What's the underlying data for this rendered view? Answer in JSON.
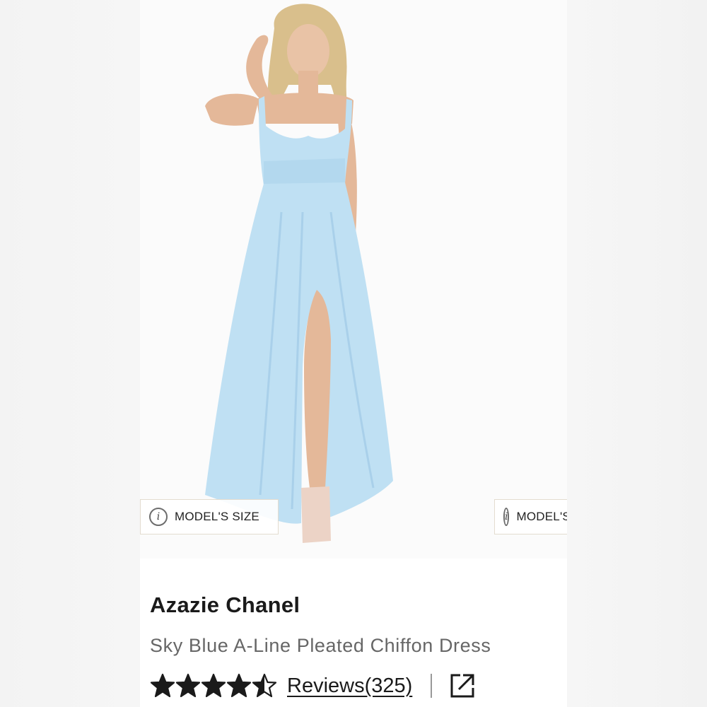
{
  "product": {
    "brand": "Azazie Chanel",
    "subtitle": "Sky Blue A-Line Pleated Chiffon Dress",
    "reviews_label": "Reviews(325)",
    "rating": 4.5,
    "rating_max": 5
  },
  "gallery": {
    "model_size_label": "MODEL'S SIZE",
    "next_model_size_label": "MODEL'S SIZE"
  },
  "icons": {
    "info": "info-icon",
    "star": "star-icon",
    "share": "external-link-icon"
  },
  "colors": {
    "dress": "#bfe0f3",
    "text_primary": "#1a1a1a",
    "text_secondary": "#666666"
  }
}
